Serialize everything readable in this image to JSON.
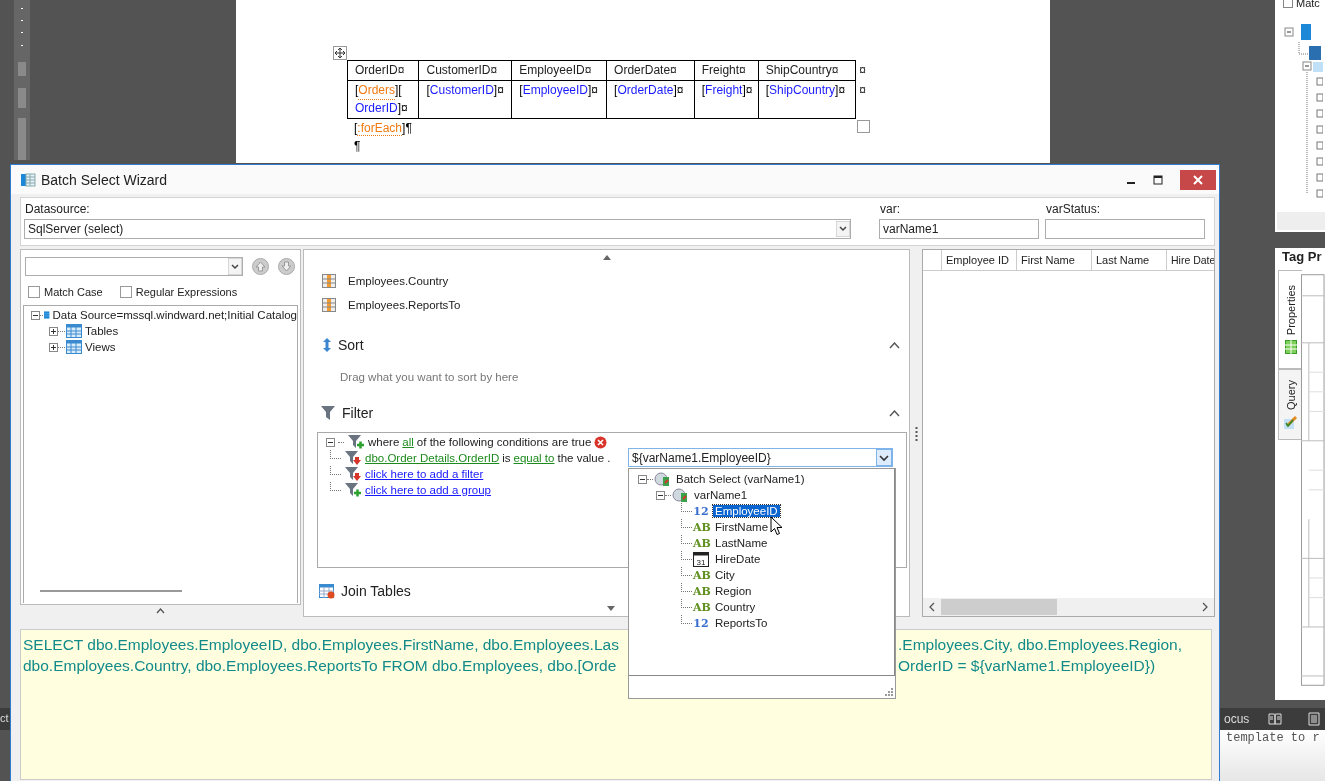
{
  "document": {
    "table": {
      "columns": [
        "OrderID¤",
        "CustomerID¤",
        "EmployeeID¤",
        "OrderDate¤",
        "Freight¤",
        "ShipCountry¤"
      ],
      "header_end": "¤",
      "row": [
        [
          {
            "text": "[",
            "kind": "mark"
          },
          {
            "text": "Orders",
            "kind": "tag"
          },
          {
            "text": "][",
            "kind": "mark"
          },
          {
            "text": "OrderID",
            "kind": "field"
          },
          {
            "text": "]¤",
            "kind": "mark"
          }
        ],
        [
          {
            "text": "[",
            "kind": "mark"
          },
          {
            "text": "CustomerID",
            "kind": "field"
          },
          {
            "text": "]¤",
            "kind": "mark"
          }
        ],
        [
          {
            "text": "[",
            "kind": "mark"
          },
          {
            "text": "EmployeeID",
            "kind": "field"
          },
          {
            "text": "]¤",
            "kind": "mark"
          }
        ],
        [
          {
            "text": "[",
            "kind": "mark"
          },
          {
            "text": "OrderDate",
            "kind": "field"
          },
          {
            "text": "]¤",
            "kind": "mark"
          }
        ],
        [
          {
            "text": "[",
            "kind": "mark"
          },
          {
            "text": "Freight",
            "kind": "field"
          },
          {
            "text": "]¤",
            "kind": "mark"
          }
        ],
        [
          {
            "text": "[",
            "kind": "mark"
          },
          {
            "text": "ShipCountry",
            "kind": "field"
          },
          {
            "text": "]¤",
            "kind": "mark"
          }
        ]
      ],
      "row_end": "¤"
    },
    "paragraphs": [
      [
        {
          "text": "[",
          "kind": "mark"
        },
        {
          "text": ":forEach",
          "kind": "tag"
        },
        {
          "text": "]¶",
          "kind": "mark"
        }
      ],
      [
        {
          "text": "¶",
          "kind": "mark"
        }
      ]
    ]
  },
  "side_panel": {
    "match_label": "Matc",
    "match_checked": false,
    "title": "Tag Pr",
    "tabs": [
      {
        "label": "Properties",
        "selected": true
      },
      {
        "label": "Query",
        "selected": false
      }
    ]
  },
  "status_bar": {
    "left": "ct",
    "right": "ocus",
    "below": "template to r"
  },
  "wizard": {
    "title": "Batch Select Wizard",
    "datasource_label": "Datasource:",
    "datasource_value": "SqlServer (select)",
    "var_label": "var:",
    "var_value": "varName1",
    "varstatus_label": "varStatus:",
    "match_case": {
      "label": "Match Case",
      "checked": false
    },
    "regex": {
      "label": "Regular Expressions",
      "checked": false
    },
    "tree": [
      {
        "label": "Data Source=mssql.windward.net;Initial Catalog",
        "expanded": true,
        "children": [
          {
            "label": "Tables",
            "expanded": false
          },
          {
            "label": "Views",
            "expanded": false
          }
        ]
      }
    ],
    "fields": [
      "Employees.Country",
      "Employees.ReportsTo"
    ],
    "sort": {
      "title": "Sort",
      "hint": "Drag what you want to sort by here"
    },
    "filter": {
      "title": "Filter",
      "group": {
        "prefix": "where",
        "quantifier": "all",
        "suffix": "of the following conditions are true",
        "expanded": true
      },
      "condition": {
        "field": "dbo.Order Details.OrderID",
        "is": "is",
        "operator": "equal to",
        "value_text": "the value ."
      },
      "add_filter": "click here to add a filter",
      "add_group": "click here to add a group"
    },
    "join": {
      "title": "Join Tables"
    },
    "value_combo": {
      "value": "${varName1.EmployeeID}"
    },
    "popup": {
      "root": "Batch Select (varName1)",
      "root_expanded": true,
      "node": "varName1",
      "node_expanded": true,
      "items": [
        {
          "label": "EmployeeID",
          "kind": "number",
          "icon_text": "12",
          "selected": true
        },
        {
          "label": "FirstName",
          "kind": "text",
          "icon_text": "AB",
          "selected": false
        },
        {
          "label": "LastName",
          "kind": "text",
          "icon_text": "AB",
          "selected": false
        },
        {
          "label": "HireDate",
          "kind": "date",
          "icon_text": "31",
          "selected": false
        },
        {
          "label": "City",
          "kind": "text",
          "icon_text": "AB",
          "selected": false
        },
        {
          "label": "Region",
          "kind": "text",
          "icon_text": "AB",
          "selected": false
        },
        {
          "label": "Country",
          "kind": "text",
          "icon_text": "AB",
          "selected": false
        },
        {
          "label": "ReportsTo",
          "kind": "number",
          "icon_text": "12",
          "selected": false
        }
      ]
    },
    "grid": {
      "columns": [
        "Employee ID",
        "First Name",
        "Last Name",
        "Hire Date"
      ]
    },
    "sql": {
      "lines": [
        {
          "left": "SELECT dbo.Employees.EmployeeID, dbo.Employees.FirstName, dbo.Employees.Las",
          "right": ".Employees.City, dbo.Employees.Region,"
        },
        {
          "left": "dbo.Employees.Country, dbo.Employees.ReportsTo FROM dbo.Employees, dbo.[Orde",
          "right": "OrderID = ${varName1.EmployeeID})"
        }
      ]
    }
  }
}
